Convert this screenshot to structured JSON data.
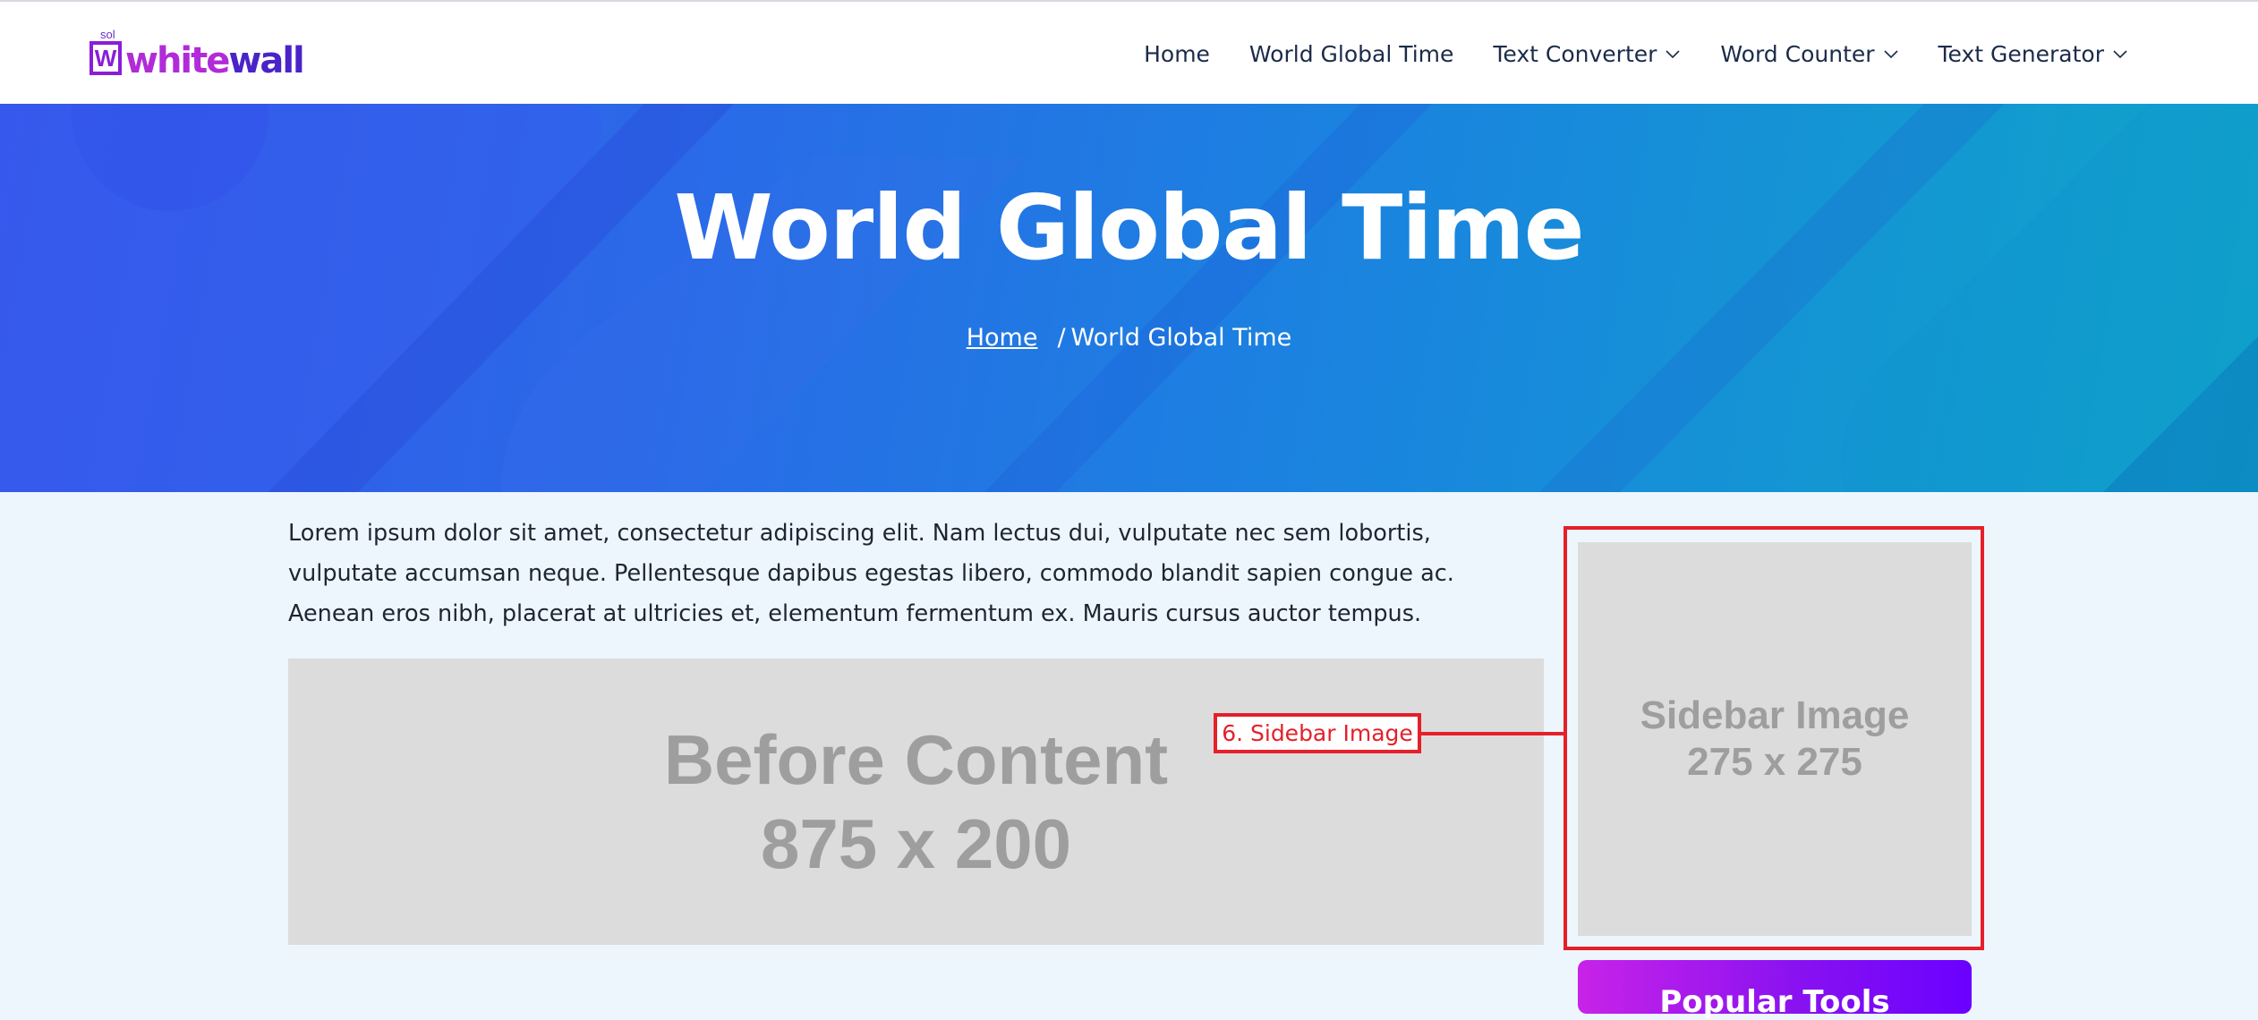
{
  "brand": {
    "sol": "sol",
    "mark": "W",
    "name_part1": "white",
    "name_part2": "wall",
    "colors": {
      "primary_purple": "#b12bd8",
      "deep_purple": "#4a23c9"
    }
  },
  "nav": {
    "items": [
      {
        "label": "Home",
        "dropdown": false
      },
      {
        "label": "World Global Time",
        "dropdown": false
      },
      {
        "label": "Text Converter",
        "dropdown": true,
        "icon": "chevron-down-icon"
      },
      {
        "label": "Word Counter",
        "dropdown": true,
        "icon": "chevron-down-icon"
      },
      {
        "label": "Text Generator",
        "dropdown": true,
        "icon": "chevron-down-icon"
      }
    ]
  },
  "hero": {
    "title": "World Global Time",
    "breadcrumb": {
      "home": "Home",
      "separator": "/",
      "current": "World Global Time"
    }
  },
  "content": {
    "intro": "Lorem ipsum dolor sit amet, consectetur adipiscing elit. Nam lectus dui, vulputate nec sem lobortis, vulputate accumsan neque. Pellentesque dapibus egestas libero, commodo blandit sapien congue ac. Aenean eros nibh, placerat at ultricies et, elementum fermentum ex. Mauris cursus auctor tempus.",
    "before_content": {
      "line1": "Before Content",
      "line2": "875 x 200"
    }
  },
  "sidebar": {
    "image": {
      "line1": "Sidebar Image",
      "line2": "275 x 275"
    },
    "popular_tools": "Popular Tools"
  },
  "annotation": {
    "label": "6. Sidebar Image",
    "color": "#e4202a"
  }
}
